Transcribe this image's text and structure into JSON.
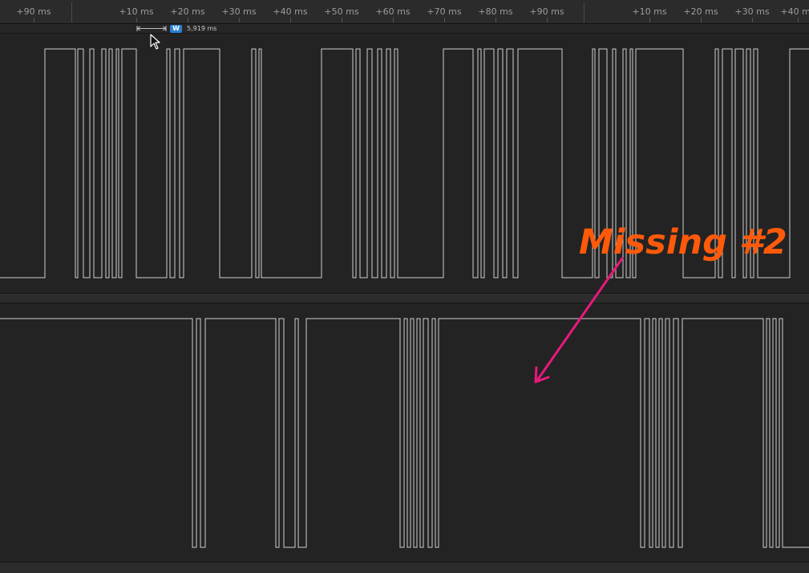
{
  "timeline": {
    "tick_labels": [
      "+90 ms",
      "+10 ms",
      "+20 ms",
      "+30 ms",
      "+40 ms",
      "+50 ms",
      "+60 ms",
      "+70 ms",
      "+80 ms",
      "+90 ms",
      "+10 ms",
      "+20 ms",
      "+30 ms",
      "+40 ms"
    ]
  },
  "measurement": {
    "badge": "W",
    "value": "5,919 ms"
  },
  "annotation": {
    "text": "Missing #2",
    "color": "#ff5a0a",
    "arrow_color": "#e8197a"
  },
  "colors": {
    "background": "#242424",
    "waveform": "#cfcfcf",
    "measure_badge": "#2d7fd3"
  }
}
